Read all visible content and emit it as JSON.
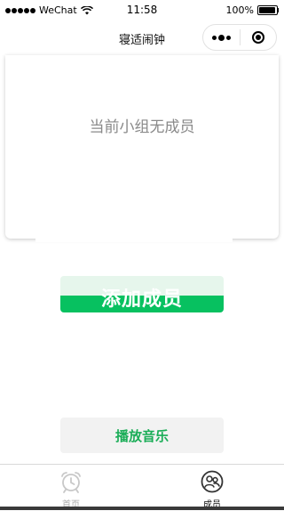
{
  "status_bar": {
    "carrier": "WeChat",
    "time": "11:58",
    "battery_percent": "100%",
    "battery_level": 1.0
  },
  "nav": {
    "title": "寝适闹钟"
  },
  "members": {
    "empty_text": "当前小组无成员"
  },
  "actions": {
    "add_member_label": "添加成员",
    "play_music_label": "播放音乐"
  },
  "tab_bar": {
    "items": [
      {
        "label": "首页",
        "icon": "alarm-clock-icon",
        "active": false
      },
      {
        "label": "成员",
        "icon": "members-icon",
        "active": true
      }
    ]
  },
  "colors": {
    "accent_green": "#07c160",
    "light_green": "#e6f6ec",
    "play_text_green": "#1aad57",
    "empty_text_gray": "#8a8a8a"
  }
}
